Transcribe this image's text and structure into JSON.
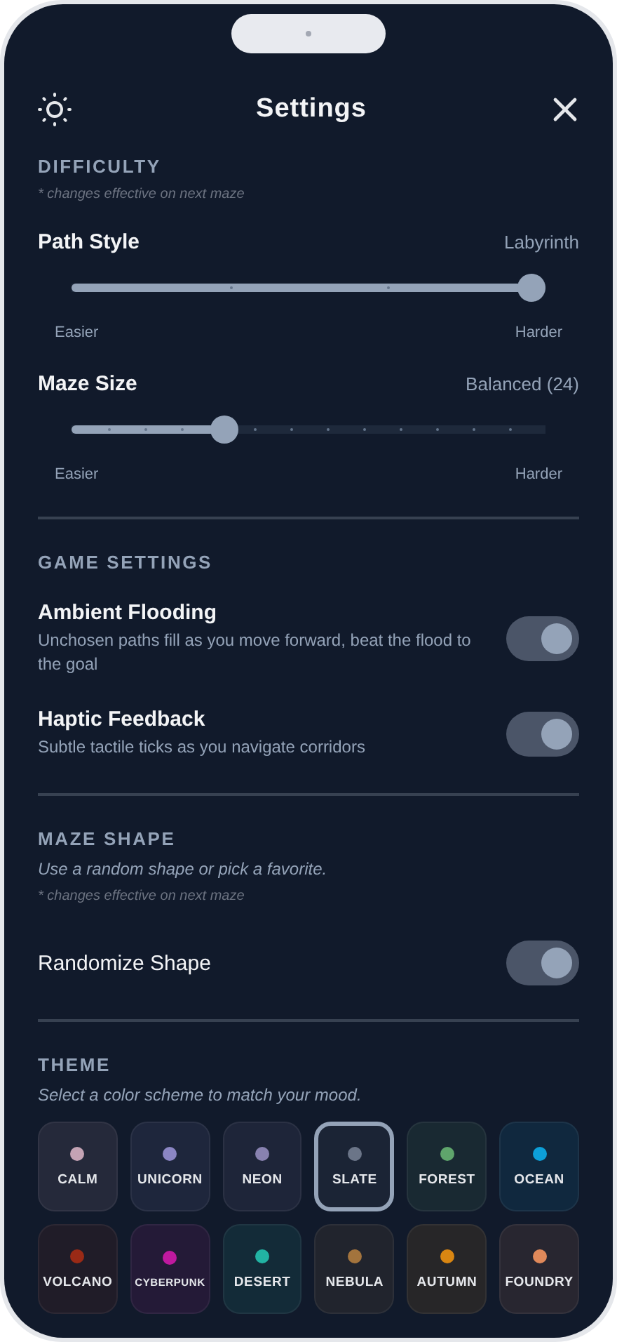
{
  "header": {
    "title": "Settings"
  },
  "difficulty": {
    "heading": "DIFFICULTY",
    "note": "* changes effective on next maze",
    "sliders": [
      {
        "label": "Path Style",
        "reading": "Labyrinth",
        "level": 1,
        "min_label": "Easier",
        "max_label": "Harder"
      },
      {
        "label": "Maze Size",
        "reading": "Balanced (24)",
        "level": 0.31,
        "min_label": "Easier",
        "max_label": "Harder"
      }
    ]
  },
  "game_settings": {
    "heading": "GAME SETTINGS",
    "toggles": [
      {
        "label": "Ambient Flooding",
        "description": "Unchosen paths fill as you move forward, beat the flood to the goal",
        "on": true
      },
      {
        "label": "Haptic Feedback",
        "description": "Subtle tactile ticks as you navigate corridors",
        "on": true
      }
    ]
  },
  "maze_shape": {
    "heading": "MAZE SHAPE",
    "subtitle": "Use a random shape or pick a favorite.",
    "note": "* changes effective on next maze",
    "toggle": {
      "label": "Randomize Shape",
      "on": true
    }
  },
  "theme": {
    "heading": "THEME",
    "subtitle": "Select a color scheme to match your mood.",
    "themes": [
      {
        "name": "CALM",
        "color": "#c4a3b4",
        "selected": false
      },
      {
        "name": "UNICORN",
        "color": "#8b86c4",
        "selected": false
      },
      {
        "name": "NEON",
        "color": "#8882b0",
        "selected": false
      },
      {
        "name": "SLATE",
        "color": "#6b7588",
        "selected": true
      },
      {
        "name": "FOREST",
        "color": "#5fa56c",
        "selected": false
      },
      {
        "name": "OCEAN",
        "color": "#0d9fd8",
        "selected": false
      },
      {
        "name": "VOLCANO",
        "color": "#9a2a16",
        "selected": false
      },
      {
        "name": "CYBERPUNK",
        "color": "#c0199f",
        "selected": false
      },
      {
        "name": "DESERT",
        "color": "#22b3a3",
        "selected": false
      },
      {
        "name": "NEBULA",
        "color": "#a3743d",
        "selected": false
      },
      {
        "name": "AUTUMN",
        "color": "#d98612",
        "selected": false
      },
      {
        "name": "FOUNDRY",
        "color": "#e0895a",
        "selected": false
      }
    ]
  }
}
